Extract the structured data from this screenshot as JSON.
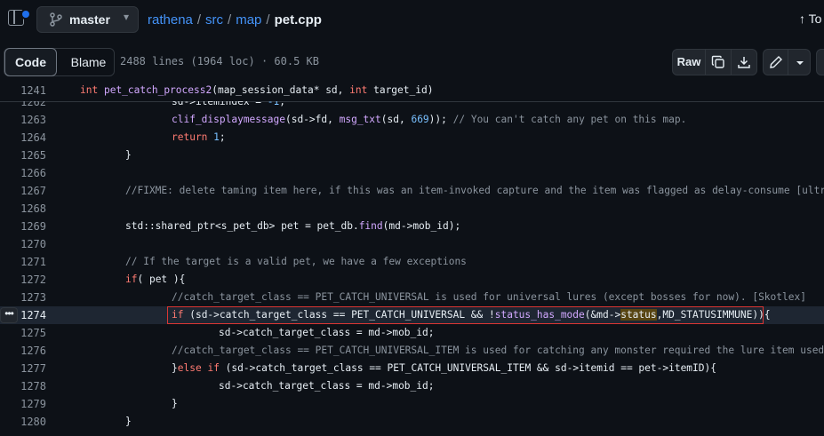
{
  "header": {
    "branch": "master",
    "breadcrumb": {
      "repo": "rathena",
      "dir1": "src",
      "dir2": "map",
      "file": "pet.cpp"
    },
    "top_right": "To"
  },
  "toolbar": {
    "tab_code": "Code",
    "tab_blame": "Blame",
    "file_meta": "2488 lines (1964 loc) · 60.5 KB",
    "raw_label": "Raw"
  },
  "sticky": {
    "line_number": "1241",
    "code": "int pet_catch_process2(map_session_data* sd, int target_id)"
  },
  "code_lines": [
    {
      "n": "1262",
      "code": "sd->itemindex = -1;"
    },
    {
      "n": "1263",
      "code": "clif_displaymessage(sd->fd, msg_txt(sd, 669)); // You can't catch any pet on this map."
    },
    {
      "n": "1264",
      "code": "return 1;"
    },
    {
      "n": "1265",
      "code": "}"
    },
    {
      "n": "1266",
      "code": ""
    },
    {
      "n": "1267",
      "code": "//FIXME: delete taming item here, if this was an item-invoked capture and the item was flagged as delay-consume [ultram"
    },
    {
      "n": "1268",
      "code": ""
    },
    {
      "n": "1269",
      "code": "std::shared_ptr<s_pet_db> pet = pet_db.find(md->mob_id);"
    },
    {
      "n": "1270",
      "code": ""
    },
    {
      "n": "1271",
      "code": "// If the target is a valid pet, we have a few exceptions"
    },
    {
      "n": "1272",
      "code": "if( pet ){"
    },
    {
      "n": "1273",
      "code": "//catch_target_class == PET_CATCH_UNIVERSAL is used for universal lures (except bosses for now). [Skotlex]"
    },
    {
      "n": "1274",
      "code": "if (sd->catch_target_class == PET_CATCH_UNIVERSAL && !status_has_mode(&md->status,MD_STATUSIMMUNE)){"
    },
    {
      "n": "1275",
      "code": "sd->catch_target_class = md->mob_id;"
    },
    {
      "n": "1276",
      "code": "//catch_target_class == PET_CATCH_UNIVERSAL_ITEM is used for catching any monster required the lure item used"
    },
    {
      "n": "1277",
      "code": "}else if (sd->catch_target_class == PET_CATCH_UNIVERSAL_ITEM && sd->itemid == pet->itemID){"
    },
    {
      "n": "1278",
      "code": "sd->catch_target_class = md->mob_id;"
    },
    {
      "n": "1279",
      "code": "}"
    },
    {
      "n": "1280",
      "code": "}"
    }
  ],
  "highlight": {
    "search_term": "status"
  }
}
